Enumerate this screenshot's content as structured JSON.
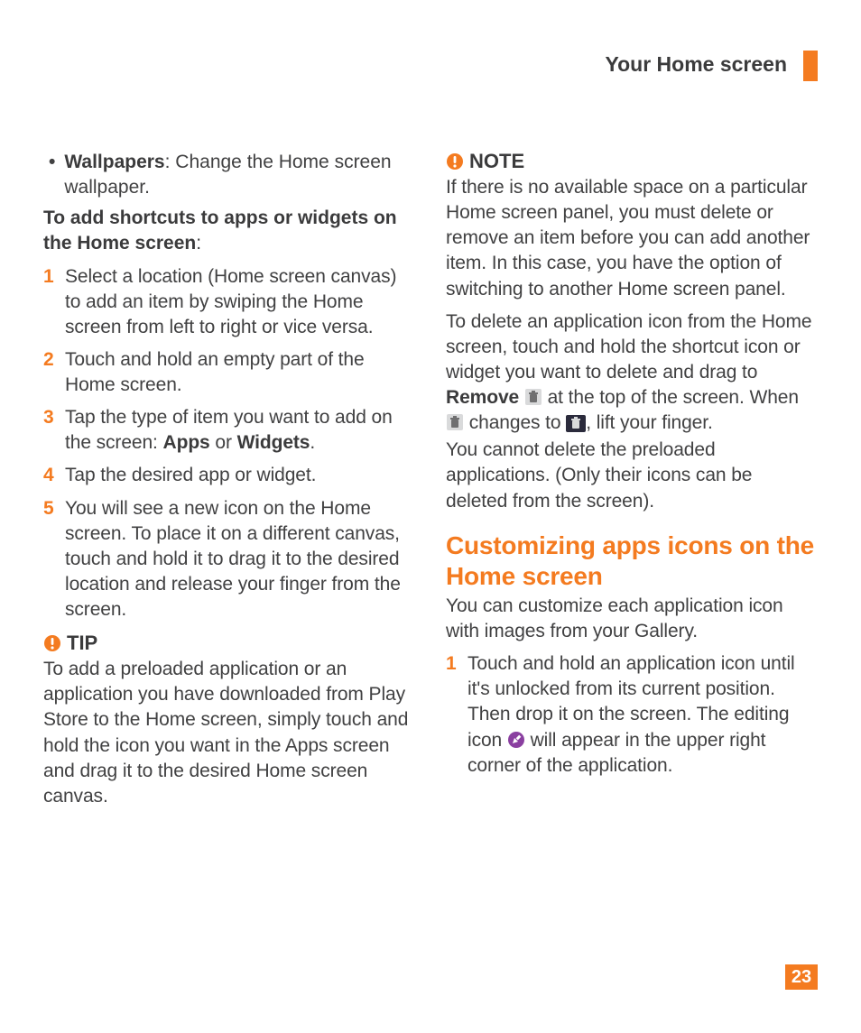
{
  "header": {
    "title": "Your Home screen"
  },
  "left": {
    "bullet": {
      "label": "Wallpapers",
      "desc": ": Change the Home screen wallpaper."
    },
    "subhead": "To add shortcuts to apps or widgets on the Home screen",
    "subhead_colon": ":",
    "steps": {
      "s1": "Select a location (Home screen canvas) to add an item by swiping the Home screen from left to right or vice versa.",
      "s2": "Touch and hold an empty part of the Home screen.",
      "s3a": "Tap the type of item you want to add on the screen: ",
      "s3b": "Apps",
      "s3c": " or ",
      "s3d": "Widgets",
      "s3e": ".",
      "s4": "Tap the desired app or widget.",
      "s5": "You will see a new icon on the Home screen. To place it on a different canvas, touch and hold it to drag it to the desired location and release your finger from the screen."
    },
    "tip": {
      "label": "TIP",
      "body": "To add a preloaded application or an application you have downloaded from Play Store to the Home screen, simply touch and hold the icon you want in the Apps screen and drag it to the desired Home screen canvas."
    }
  },
  "right": {
    "note": {
      "label": "NOTE",
      "body": "If there is no available space on a particular Home screen panel, you must delete or remove an item before you can add another item. In this case, you have the option of switching to another Home screen panel."
    },
    "delete": {
      "p1": "To delete an application icon from the Home screen, touch and hold the shortcut icon or widget you want to delete and drag to ",
      "remove": "Remove",
      "p2": " at the top of the screen. When ",
      "p3": " changes to ",
      "p4": ", lift your finger.",
      "p5": "You cannot delete the preloaded applications. (Only their icons can be deleted from the screen)."
    },
    "section_title": "Customizing apps icons on the Home screen",
    "section_intro": "You can customize each application icon with images from your Gallery.",
    "steps": {
      "s1a": "Touch and hold an application icon until it's unlocked from its current position. Then drop it on the screen. The editing icon ",
      "s1b": " will appear in the upper right corner of the application."
    }
  },
  "page_number": "23"
}
